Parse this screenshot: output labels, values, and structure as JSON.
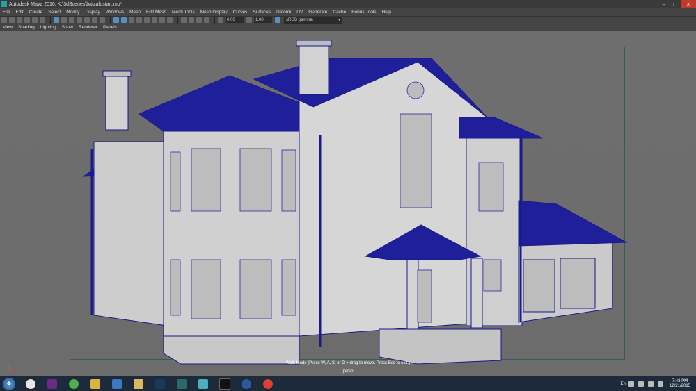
{
  "window": {
    "title": "Autodesk Maya 2016: K:\\3dScenes\\batzafustart.mb*",
    "minimize": "–",
    "maximize": "□",
    "close": "✕"
  },
  "menu": [
    "File",
    "Edit",
    "Create",
    "Select",
    "Modify",
    "Display",
    "Windows",
    "Mesh",
    "Edit Mesh",
    "Mesh Tools",
    "Mesh Display",
    "Curves",
    "Surfaces",
    "Deform",
    "UV",
    "Generate",
    "Cache",
    "Bonus Tools",
    "Help"
  ],
  "toolbar": {
    "exposure": "0.00",
    "gamma": "1.00",
    "color_space": "sRGB gamma"
  },
  "panel_menu": [
    "View",
    "Shading",
    "Lighting",
    "Show",
    "Renderer",
    "Panels"
  ],
  "viewport": {
    "hud_message": "Walk Mode (Press W, A, S, or D + drag to move. Press Esc to exit.)",
    "camera": "persp"
  },
  "taskbar": {
    "start_icon": "windows-logo",
    "apps": [
      {
        "name": "clock-app",
        "color": "#e8e8e8"
      },
      {
        "name": "app-purple",
        "color": "#6a2a8a"
      },
      {
        "name": "utorrent",
        "color": "#4caf50"
      },
      {
        "name": "explorer",
        "color": "#e0b040"
      },
      {
        "name": "monitor",
        "color": "#3a7ac0"
      },
      {
        "name": "folder",
        "color": "#d8b860"
      },
      {
        "name": "photoshop",
        "color": "#1b3a5a"
      },
      {
        "name": "maya-app",
        "color": "#2a6a6a"
      },
      {
        "name": "house-app",
        "color": "#4ab0c0"
      },
      {
        "name": "unreal",
        "color": "#111"
      },
      {
        "name": "vray",
        "color": "#2a5aa0"
      },
      {
        "name": "chrome",
        "color": "#e04030"
      }
    ],
    "lang": "EN",
    "time": "7:43 PM",
    "date": "12/21/2015"
  }
}
